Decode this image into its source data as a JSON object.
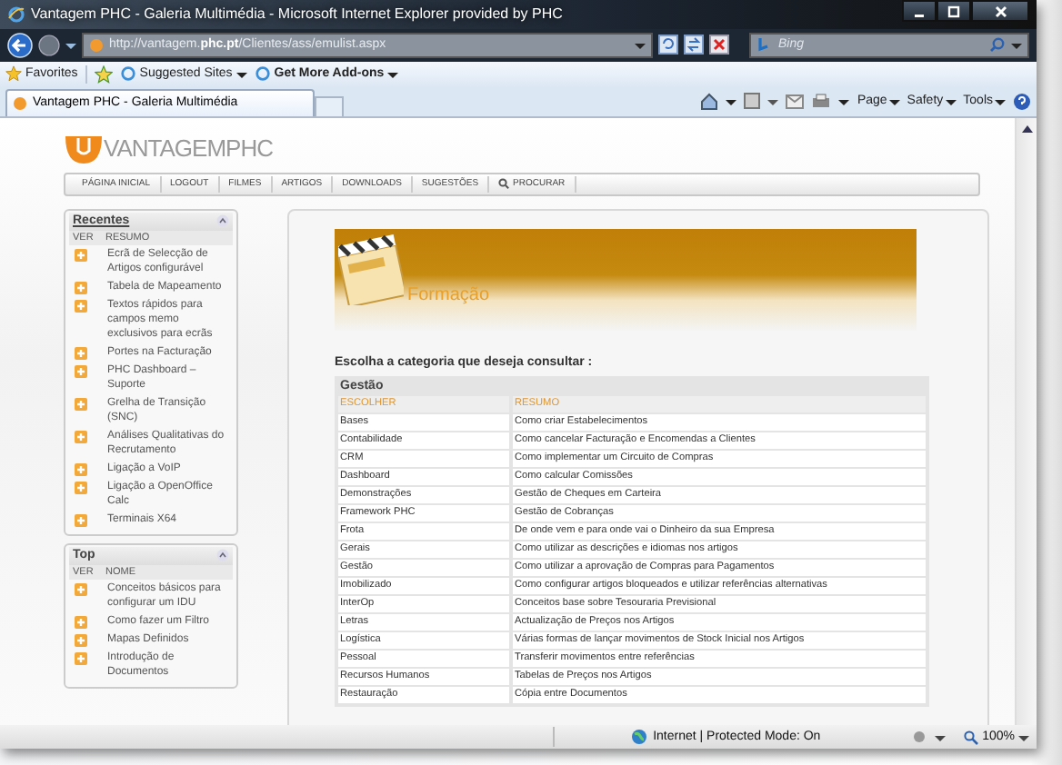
{
  "window": {
    "title": "Vantagem PHC - Galeria Multimédia - Microsoft Internet Explorer provided by PHC"
  },
  "address_bar": {
    "url_prefix": "http://vantagem.",
    "url_domain": "phc.pt",
    "url_path": "/Clientes/ass/emulist.aspx"
  },
  "search": {
    "placeholder": "Bing"
  },
  "favorites_bar": {
    "favorites": "Favorites",
    "links": [
      {
        "label": "Suggested Sites",
        "bold": false
      },
      {
        "label": "Get More Add-ons",
        "bold": true
      }
    ]
  },
  "tab": {
    "title": "Vantagem PHC - Galeria Multimédia"
  },
  "command_bar": [
    "Page",
    "Safety",
    "Tools"
  ],
  "page": {
    "logo": "VANTAGEMPHC",
    "nav": [
      {
        "label": "PÁGINA INICIAL",
        "kind": "link"
      },
      {
        "label": "LOGOUT",
        "kind": "link"
      },
      {
        "label": "FILMES",
        "kind": "link"
      },
      {
        "label": "ARTIGOS",
        "kind": "link"
      },
      {
        "label": "DOWNLOADS",
        "kind": "link"
      },
      {
        "label": "SUGESTÕES",
        "kind": "link"
      },
      {
        "label": "PROCURAR",
        "kind": "search"
      }
    ],
    "sidebar": [
      {
        "title": "Recentes",
        "underlined": true,
        "columns": [
          "VER",
          "RESUMO"
        ],
        "items": [
          "Ecrã de Selecção de Artigos configurável",
          "Tabela de Mapeamento",
          "Textos rápidos para campos memo exclusivos para ecrãs",
          "Portes na Facturação",
          "PHC Dashboard – Suporte",
          "Grelha de Transição (SNC)",
          "Análises Qualitativas do Recrutamento",
          "Ligação a VoIP",
          "Ligação a OpenOffice Calc",
          "Terminais X64"
        ]
      },
      {
        "title": "Top",
        "underlined": false,
        "columns": [
          "VER",
          "NOME"
        ],
        "items": [
          "Conceitos básicos para configurar um IDU",
          "Como fazer um Filtro",
          "Mapas Definidos",
          "Introdução de Documentos"
        ]
      }
    ],
    "banner_title": "Formação",
    "prompt": "Escolha a categoria que deseja consultar :",
    "table": {
      "group": "Gestão",
      "columns": [
        "ESCOLHER",
        "RESUMO"
      ],
      "rows": [
        [
          "Bases",
          "Como criar Estabelecimentos"
        ],
        [
          "Contabilidade",
          "Como cancelar Facturação e Encomendas a Clientes"
        ],
        [
          "CRM",
          "Como implementar um Circuito de Compras"
        ],
        [
          "Dashboard",
          "Como calcular Comissões"
        ],
        [
          "Demonstrações",
          "Gestão de Cheques em Carteira"
        ],
        [
          "Framework PHC",
          "Gestão de Cobranças"
        ],
        [
          "Frota",
          "De onde vem e para onde vai o Dinheiro da sua Empresa"
        ],
        [
          "Gerais",
          "Como utilizar as descrições e idiomas nos artigos"
        ],
        [
          "Gestão",
          "Como utilizar a aprovação de Compras para Pagamentos"
        ],
        [
          "Imobilizado",
          "Como configurar artigos bloqueados e utilizar referências alternativas"
        ],
        [
          "InterOp",
          "Conceitos base sobre Tesouraria Previsional"
        ],
        [
          "Letras",
          "Actualização de Preços nos Artigos"
        ],
        [
          "Logística",
          "Várias formas de lançar movimentos de Stock Inicial nos Artigos"
        ],
        [
          "Pessoal",
          "Transferir movimentos entre referências"
        ],
        [
          "Recursos Humanos",
          "Tabelas de Preços nos Artigos"
        ],
        [
          "Restauração",
          "Cópia entre Documentos"
        ]
      ]
    }
  },
  "status_bar": {
    "zone": "Internet | Protected Mode: On",
    "zoom": "100%"
  }
}
